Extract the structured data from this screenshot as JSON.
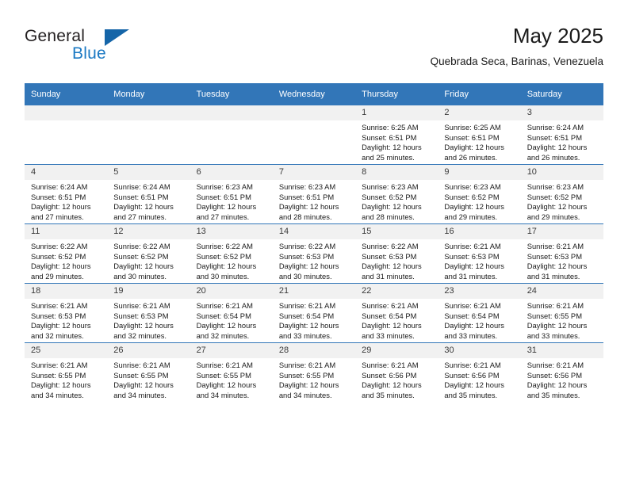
{
  "brand": {
    "word_one": "General",
    "word_two": "Blue",
    "flag_icon": "triangle-flag-icon"
  },
  "header": {
    "title": "May 2025",
    "location": "Quebrada Seca, Barinas, Venezuela"
  },
  "calendar": {
    "weekday_headers": [
      "Sunday",
      "Monday",
      "Tuesday",
      "Wednesday",
      "Thursday",
      "Friday",
      "Saturday"
    ],
    "accent_color": "#3276b8",
    "daynum_bg": "#f1f1f1",
    "weeks": [
      [
        {
          "day": "",
          "empty": true,
          "lines": []
        },
        {
          "day": "",
          "empty": true,
          "lines": []
        },
        {
          "day": "",
          "empty": true,
          "lines": []
        },
        {
          "day": "",
          "empty": true,
          "lines": []
        },
        {
          "day": "1",
          "empty": false,
          "lines": [
            "Sunrise: 6:25 AM",
            "Sunset: 6:51 PM",
            "Daylight: 12 hours",
            "and 25 minutes."
          ]
        },
        {
          "day": "2",
          "empty": false,
          "lines": [
            "Sunrise: 6:25 AM",
            "Sunset: 6:51 PM",
            "Daylight: 12 hours",
            "and 26 minutes."
          ]
        },
        {
          "day": "3",
          "empty": false,
          "lines": [
            "Sunrise: 6:24 AM",
            "Sunset: 6:51 PM",
            "Daylight: 12 hours",
            "and 26 minutes."
          ]
        }
      ],
      [
        {
          "day": "4",
          "empty": false,
          "lines": [
            "Sunrise: 6:24 AM",
            "Sunset: 6:51 PM",
            "Daylight: 12 hours",
            "and 27 minutes."
          ]
        },
        {
          "day": "5",
          "empty": false,
          "lines": [
            "Sunrise: 6:24 AM",
            "Sunset: 6:51 PM",
            "Daylight: 12 hours",
            "and 27 minutes."
          ]
        },
        {
          "day": "6",
          "empty": false,
          "lines": [
            "Sunrise: 6:23 AM",
            "Sunset: 6:51 PM",
            "Daylight: 12 hours",
            "and 27 minutes."
          ]
        },
        {
          "day": "7",
          "empty": false,
          "lines": [
            "Sunrise: 6:23 AM",
            "Sunset: 6:51 PM",
            "Daylight: 12 hours",
            "and 28 minutes."
          ]
        },
        {
          "day": "8",
          "empty": false,
          "lines": [
            "Sunrise: 6:23 AM",
            "Sunset: 6:52 PM",
            "Daylight: 12 hours",
            "and 28 minutes."
          ]
        },
        {
          "day": "9",
          "empty": false,
          "lines": [
            "Sunrise: 6:23 AM",
            "Sunset: 6:52 PM",
            "Daylight: 12 hours",
            "and 29 minutes."
          ]
        },
        {
          "day": "10",
          "empty": false,
          "lines": [
            "Sunrise: 6:23 AM",
            "Sunset: 6:52 PM",
            "Daylight: 12 hours",
            "and 29 minutes."
          ]
        }
      ],
      [
        {
          "day": "11",
          "empty": false,
          "lines": [
            "Sunrise: 6:22 AM",
            "Sunset: 6:52 PM",
            "Daylight: 12 hours",
            "and 29 minutes."
          ]
        },
        {
          "day": "12",
          "empty": false,
          "lines": [
            "Sunrise: 6:22 AM",
            "Sunset: 6:52 PM",
            "Daylight: 12 hours",
            "and 30 minutes."
          ]
        },
        {
          "day": "13",
          "empty": false,
          "lines": [
            "Sunrise: 6:22 AM",
            "Sunset: 6:52 PM",
            "Daylight: 12 hours",
            "and 30 minutes."
          ]
        },
        {
          "day": "14",
          "empty": false,
          "lines": [
            "Sunrise: 6:22 AM",
            "Sunset: 6:53 PM",
            "Daylight: 12 hours",
            "and 30 minutes."
          ]
        },
        {
          "day": "15",
          "empty": false,
          "lines": [
            "Sunrise: 6:22 AM",
            "Sunset: 6:53 PM",
            "Daylight: 12 hours",
            "and 31 minutes."
          ]
        },
        {
          "day": "16",
          "empty": false,
          "lines": [
            "Sunrise: 6:21 AM",
            "Sunset: 6:53 PM",
            "Daylight: 12 hours",
            "and 31 minutes."
          ]
        },
        {
          "day": "17",
          "empty": false,
          "lines": [
            "Sunrise: 6:21 AM",
            "Sunset: 6:53 PM",
            "Daylight: 12 hours",
            "and 31 minutes."
          ]
        }
      ],
      [
        {
          "day": "18",
          "empty": false,
          "lines": [
            "Sunrise: 6:21 AM",
            "Sunset: 6:53 PM",
            "Daylight: 12 hours",
            "and 32 minutes."
          ]
        },
        {
          "day": "19",
          "empty": false,
          "lines": [
            "Sunrise: 6:21 AM",
            "Sunset: 6:53 PM",
            "Daylight: 12 hours",
            "and 32 minutes."
          ]
        },
        {
          "day": "20",
          "empty": false,
          "lines": [
            "Sunrise: 6:21 AM",
            "Sunset: 6:54 PM",
            "Daylight: 12 hours",
            "and 32 minutes."
          ]
        },
        {
          "day": "21",
          "empty": false,
          "lines": [
            "Sunrise: 6:21 AM",
            "Sunset: 6:54 PM",
            "Daylight: 12 hours",
            "and 33 minutes."
          ]
        },
        {
          "day": "22",
          "empty": false,
          "lines": [
            "Sunrise: 6:21 AM",
            "Sunset: 6:54 PM",
            "Daylight: 12 hours",
            "and 33 minutes."
          ]
        },
        {
          "day": "23",
          "empty": false,
          "lines": [
            "Sunrise: 6:21 AM",
            "Sunset: 6:54 PM",
            "Daylight: 12 hours",
            "and 33 minutes."
          ]
        },
        {
          "day": "24",
          "empty": false,
          "lines": [
            "Sunrise: 6:21 AM",
            "Sunset: 6:55 PM",
            "Daylight: 12 hours",
            "and 33 minutes."
          ]
        }
      ],
      [
        {
          "day": "25",
          "empty": false,
          "lines": [
            "Sunrise: 6:21 AM",
            "Sunset: 6:55 PM",
            "Daylight: 12 hours",
            "and 34 minutes."
          ]
        },
        {
          "day": "26",
          "empty": false,
          "lines": [
            "Sunrise: 6:21 AM",
            "Sunset: 6:55 PM",
            "Daylight: 12 hours",
            "and 34 minutes."
          ]
        },
        {
          "day": "27",
          "empty": false,
          "lines": [
            "Sunrise: 6:21 AM",
            "Sunset: 6:55 PM",
            "Daylight: 12 hours",
            "and 34 minutes."
          ]
        },
        {
          "day": "28",
          "empty": false,
          "lines": [
            "Sunrise: 6:21 AM",
            "Sunset: 6:55 PM",
            "Daylight: 12 hours",
            "and 34 minutes."
          ]
        },
        {
          "day": "29",
          "empty": false,
          "lines": [
            "Sunrise: 6:21 AM",
            "Sunset: 6:56 PM",
            "Daylight: 12 hours",
            "and 35 minutes."
          ]
        },
        {
          "day": "30",
          "empty": false,
          "lines": [
            "Sunrise: 6:21 AM",
            "Sunset: 6:56 PM",
            "Daylight: 12 hours",
            "and 35 minutes."
          ]
        },
        {
          "day": "31",
          "empty": false,
          "lines": [
            "Sunrise: 6:21 AM",
            "Sunset: 6:56 PM",
            "Daylight: 12 hours",
            "and 35 minutes."
          ]
        }
      ]
    ]
  }
}
